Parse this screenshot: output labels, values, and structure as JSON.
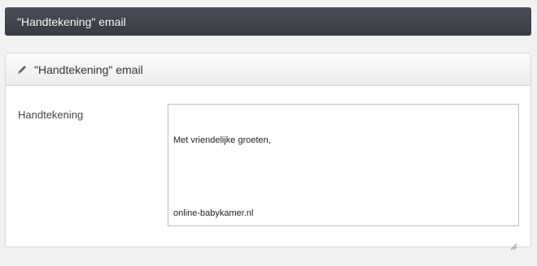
{
  "top_bar": {
    "title": "\"Handtekening\" email"
  },
  "panel": {
    "title": "\"Handtekening\" email",
    "icon": "pencil-icon",
    "field_label": "Handtekening",
    "signature_lines": [
      "Met vriendelijke groeten,",
      "",
      "online-babykamer.nl"
    ]
  },
  "colors": {
    "top_bar": "#41444c",
    "panel_header": "#f2f2f2",
    "page_background": "#f2f2f2"
  }
}
